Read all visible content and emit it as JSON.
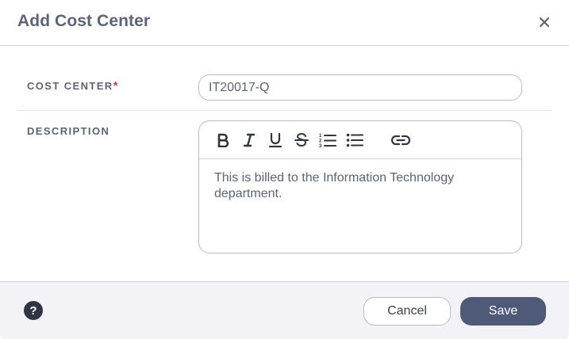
{
  "dialog": {
    "title": "Add Cost Center"
  },
  "form": {
    "cost_center": {
      "label": "COST CENTER",
      "required_marker": "*",
      "value": "IT20017-Q"
    },
    "description": {
      "label": "DESCRIPTION",
      "value": "This is billed to the Information Technology department."
    }
  },
  "toolbar": {
    "tools": [
      "bold-icon",
      "italic-icon",
      "underline-icon",
      "strikethrough-icon",
      "ordered-list-icon",
      "unordered-list-icon",
      "link-icon"
    ]
  },
  "footer": {
    "help_label": "?",
    "cancel_label": "Cancel",
    "save_label": "Save"
  },
  "colors": {
    "primary": "#4f5a78",
    "required": "#d93a3a",
    "footer_bg": "#f3f3f7",
    "text": "#5b6478"
  }
}
